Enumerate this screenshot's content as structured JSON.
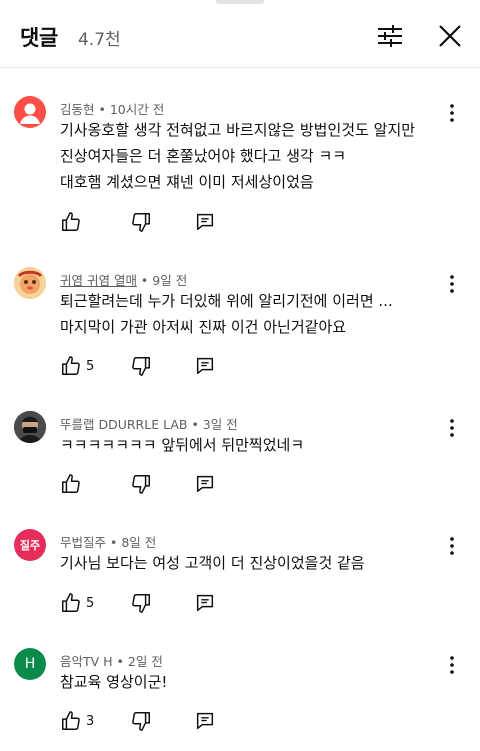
{
  "header": {
    "title": "댓글",
    "count": "4.7천"
  },
  "comments": [
    {
      "author": "김동현",
      "time": "10시간 전",
      "avatar_type": "person-icon",
      "avatar_color": "#ff4e45",
      "lines": [
        "기사옹호할 생각 전혀없고 바르지않은 방법인것도 알지만",
        "진상여자들은 더 혼쭐났어야 했다고 생각 ㅋㅋ",
        "대호햄 계셨으면 쟤넨 이미 저세상이었음"
      ],
      "likes": ""
    },
    {
      "author": "귀염 귀염 열매",
      "time": "9일 전",
      "avatar_type": "photo",
      "avatar_color": "#e7a15c",
      "lines": [
        "퇴근할려는데 누가 더있해 위에 알리기전에 이러면 ...",
        "마지막이 가관 아저씨 진짜 이건 아닌거같아요"
      ],
      "likes": "5"
    },
    {
      "author": "뚜를랩 DDURRLE LAB",
      "time": "3일 전",
      "avatar_type": "photo",
      "avatar_color": "#3a3a3a",
      "lines": [
        "ㅋㅋㅋㅋㅋㅋㅋ  앞뒤에서 뒤만찍었네ㅋ"
      ],
      "likes": ""
    },
    {
      "author": "무법질주",
      "time": "8일 전",
      "avatar_type": "text",
      "avatar_text": "질주",
      "avatar_color": "#e52d5b",
      "lines": [
        "기사님 보다는 여성 고객이 더 진상이었을것 같음"
      ],
      "likes": "5"
    },
    {
      "author": "음악TV H",
      "time": "2일 전",
      "avatar_type": "text",
      "avatar_text": "H",
      "avatar_color": "#0b8a4a",
      "lines": [
        "참교육 영상이군!"
      ],
      "likes": "3"
    }
  ]
}
